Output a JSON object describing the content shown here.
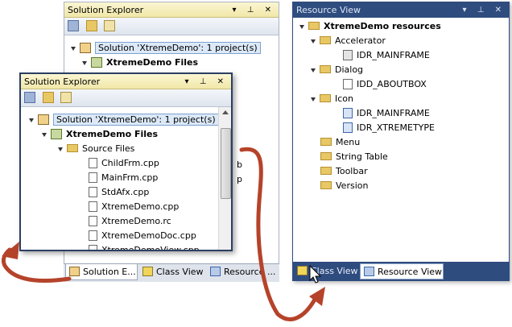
{
  "back_solution_explorer": {
    "title": "Solution Explorer",
    "title_buttons": "▾ ⊥ ✕",
    "solution": "Solution 'XtremeDemo': 1 project(s)",
    "project": "XtremeDemo Files",
    "partial_b": "b",
    "partial_p": "p"
  },
  "front_solution_explorer": {
    "title": "Solution Explorer",
    "title_buttons": "▾ ⊥ ✕",
    "solution": "Solution 'XtremeDemo': 1 project(s)",
    "project": "XtremeDemo Files",
    "folder": "Source Files",
    "files": [
      "ChildFrm.cpp",
      "MainFrm.cpp",
      "StdAfx.cpp",
      "XtremeDemo.cpp",
      "XtremeDemo.rc",
      "XtremeDemoDoc.cpp",
      "XtremeDemoView.cpp"
    ]
  },
  "bottom_tabs_left": [
    {
      "label": "Solution E...",
      "icon": "solution-icon"
    },
    {
      "label": "Class View",
      "icon": "class-view-icon"
    },
    {
      "label": "Resource ...",
      "icon": "resource-icon"
    }
  ],
  "resource_view": {
    "title": "Resource View",
    "title_buttons": "▾ ⊥ ✕",
    "root": "XtremeDemo resources",
    "accelerator": "Accelerator",
    "acc_item": "IDR_MAINFRAME",
    "dialog": "Dialog",
    "dialog_item": "IDD_ABOUTBOX",
    "icon": "Icon",
    "icon_item1": "IDR_MAINFRAME",
    "icon_item2": "IDR_XTREMETYPE",
    "menu": "Menu",
    "string_table": "String Table",
    "toolbar": "Toolbar",
    "version": "Version"
  },
  "bottom_tabs_right": [
    {
      "label": "Class View",
      "icon": "class-view-icon"
    },
    {
      "label": "Resource View",
      "icon": "resource-icon"
    }
  ],
  "colors": {
    "dark_title": "#2f4c7f",
    "arrow": "#b5432a",
    "dark_tabbar": "#2f4c7f"
  }
}
